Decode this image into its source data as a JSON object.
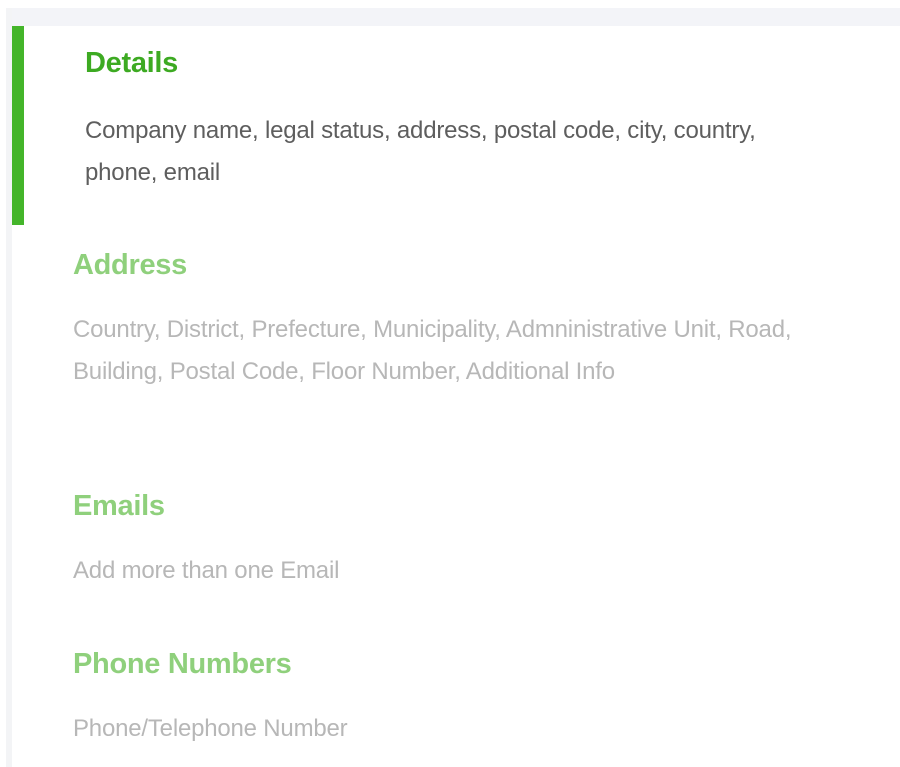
{
  "steps": [
    {
      "title": "Details",
      "description": "Company name, legal status, address, postal code, city, country, phone, email",
      "active": true
    },
    {
      "title": "Address",
      "description": "Country, District, Prefecture, Municipality, Admninistrative Unit, Road, Building, Postal Code, Floor Number, Additional Info",
      "active": false
    },
    {
      "title": "Emails",
      "description": "Add more than one Email",
      "active": false
    },
    {
      "title": "Phone Numbers",
      "description": "Phone/Telephone Number",
      "active": false
    }
  ],
  "colors": {
    "active_bar": "#44b52a",
    "active_title": "#3daa22",
    "active_text": "#5e5e5e",
    "inactive_title": "#8fd07c",
    "inactive_text": "#b7b7b7",
    "top_strip": "#f3f4f8"
  }
}
